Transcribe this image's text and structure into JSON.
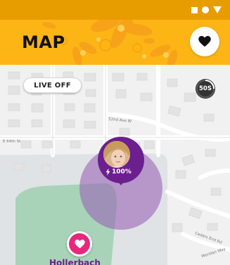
{
  "header": {
    "title": "MAP",
    "favorites_icon": "heart-icon",
    "colors": {
      "status_bar": "#e79c00",
      "header": "#fdb515"
    }
  },
  "status_bar": {
    "icons": [
      "square-icon",
      "dot-icon",
      "signal-triangle-icon"
    ]
  },
  "map": {
    "live_toggle_label": "LIVE OFF",
    "refresh_timer_label": "50S",
    "road_labels": {
      "street_52nd": "52nd Ave W",
      "street_64th": "E 64th St",
      "cedars_end": "Cedars End Rd",
      "meridian": "Meridan Way"
    },
    "child": {
      "battery": "100%",
      "battery_icon": "lightning-bolt-icon",
      "pin_color": "#6c1f8e"
    },
    "place": {
      "name": "Hollerbach",
      "icon": "heart-icon",
      "marker_color": "#e8287c"
    }
  }
}
